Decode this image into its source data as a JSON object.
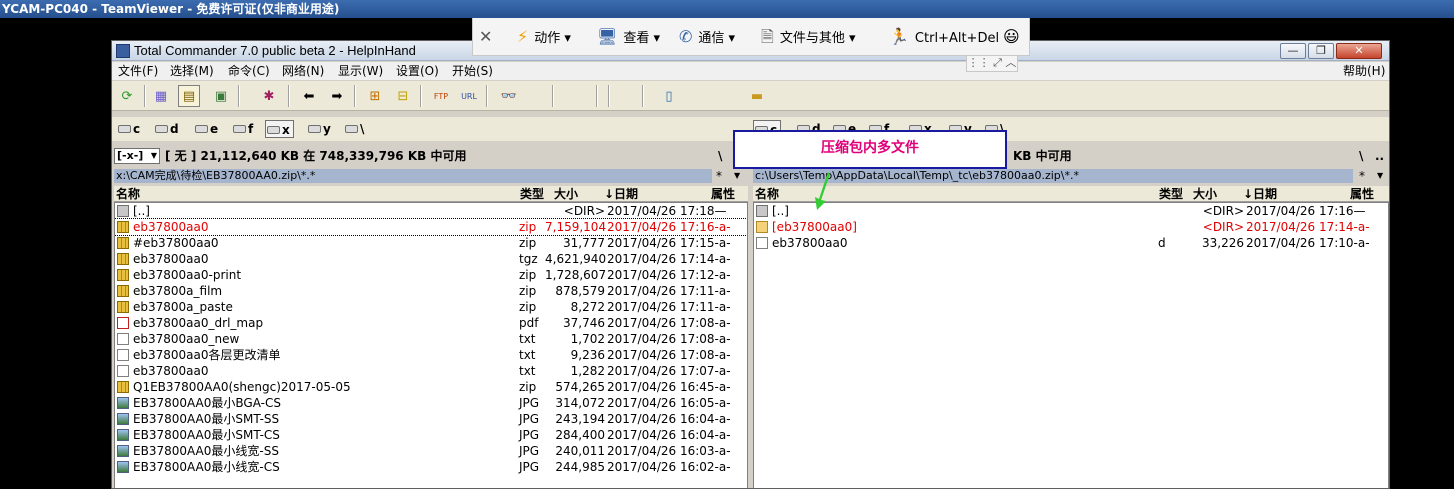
{
  "teamviewer": {
    "title": "YCAM-PC040 - TeamViewer - 免费许可证(仅非商业用途)",
    "toolbar": {
      "close_glyph": "✕",
      "action": "动作",
      "view": "查看",
      "comm": "通信",
      "files": "文件与其他",
      "cad": "Ctrl+Alt+Del",
      "smiley": "😃"
    },
    "sub": "⋮⋮ ⤢ ︿"
  },
  "tc": {
    "title": "Total Commander 7.0 public beta 2 - HelpInHand",
    "winbtn": {
      "min": "—",
      "max": "❐",
      "close": "✕"
    },
    "menu": [
      "文件(F)",
      "选择(M)",
      "命令(C)",
      "网络(N)",
      "显示(W)",
      "设置(O)",
      "开始(S)"
    ],
    "help": "帮助(H)",
    "drives_left": [
      "c",
      "d",
      "e",
      "f",
      "x",
      "y",
      "\\"
    ],
    "drives_right": [
      "c",
      "d",
      "e",
      "f",
      "x",
      "y",
      "\\"
    ],
    "left": {
      "drive_select": "[-x-]",
      "free_info": "[ 无 ]  21,112,640 KB 在 748,339,796 KB 中可用",
      "root_btn": "\\",
      "dots_btn": "..",
      "path": "x:\\CAM完成\\待检\\EB37800AA0.zip\\*.*",
      "star": "*",
      "caret": "▼",
      "columns": {
        "name": "名称",
        "type": "类型",
        "size": "大小",
        "date": "↓日期",
        "attr": "属性"
      },
      "rows": [
        {
          "name": "[..]",
          "type": "",
          "size": "<DIR>",
          "date": "2017/04/26 17:18—",
          "icon": "up",
          "color": "normal"
        },
        {
          "name": "eb37800aa0",
          "type": "zip",
          "size": "7,159,104",
          "date": "2017/04/26 17:16-a-",
          "icon": "zip",
          "color": "red"
        },
        {
          "name": "#eb37800aa0",
          "type": "zip",
          "size": "31,777",
          "date": "2017/04/26 17:15-a-",
          "icon": "zip",
          "color": "normal"
        },
        {
          "name": "eb37800aa0",
          "type": "tgz",
          "size": "4,621,940",
          "date": "2017/04/26 17:14-a-",
          "icon": "zip",
          "color": "normal"
        },
        {
          "name": "eb37800aa0-print",
          "type": "zip",
          "size": "1,728,607",
          "date": "2017/04/26 17:12-a-",
          "icon": "zip",
          "color": "normal"
        },
        {
          "name": "eb37800a_film",
          "type": "zip",
          "size": "878,579",
          "date": "2017/04/26 17:11-a-",
          "icon": "zip",
          "color": "normal"
        },
        {
          "name": "eb37800a_paste",
          "type": "zip",
          "size": "8,272",
          "date": "2017/04/26 17:11-a-",
          "icon": "zip",
          "color": "normal"
        },
        {
          "name": "eb37800aa0_drl_map",
          "type": "pdf",
          "size": "37,746",
          "date": "2017/04/26 17:08-a-",
          "icon": "pdf",
          "color": "normal"
        },
        {
          "name": "eb37800aa0_new",
          "type": "txt",
          "size": "1,702",
          "date": "2017/04/26 17:08-a-",
          "icon": "doc",
          "color": "normal"
        },
        {
          "name": "eb37800aa0各层更改清单",
          "type": "txt",
          "size": "9,236",
          "date": "2017/04/26 17:08-a-",
          "icon": "doc",
          "color": "normal"
        },
        {
          "name": "eb37800aa0",
          "type": "txt",
          "size": "1,282",
          "date": "2017/04/26 17:07-a-",
          "icon": "doc",
          "color": "normal"
        },
        {
          "name": "Q1EB37800AA0(shengc)2017-05-05",
          "type": "zip",
          "size": "574,265",
          "date": "2017/04/26 16:45-a-",
          "icon": "zip",
          "color": "normal"
        },
        {
          "name": "EB37800AA0最小BGA-CS",
          "type": "JPG",
          "size": "314,072",
          "date": "2017/04/26 16:05-a-",
          "icon": "img",
          "color": "normal"
        },
        {
          "name": "EB37800AA0最小SMT-SS",
          "type": "JPG",
          "size": "243,194",
          "date": "2017/04/26 16:04-a-",
          "icon": "img",
          "color": "normal"
        },
        {
          "name": "EB37800AA0最小SMT-CS",
          "type": "JPG",
          "size": "284,400",
          "date": "2017/04/26 16:04-a-",
          "icon": "img",
          "color": "normal"
        },
        {
          "name": "EB37800AA0最小线宽-SS",
          "type": "JPG",
          "size": "240,011",
          "date": "2017/04/26 16:03-a-",
          "icon": "img",
          "color": "normal"
        },
        {
          "name": "EB37800AA0最小线宽-CS",
          "type": "JPG",
          "size": "244,985",
          "date": "2017/04/26 16:02-a-",
          "icon": "img",
          "color": "normal"
        }
      ]
    },
    "right": {
      "free_info": "KB 中可用",
      "root_btn": "\\",
      "dots_btn": "..",
      "path": "c:\\Users\\Temp\\AppData\\Local\\Temp\\_tc\\eb37800aa0.zip\\*.*",
      "star": "*",
      "caret": "▼",
      "columns": {
        "name": "名称",
        "type": "类型",
        "size": "大小",
        "date": "↓日期",
        "attr": "属性"
      },
      "rows": [
        {
          "name": "[..]",
          "type": "",
          "size": "<DIR>",
          "date": "2017/04/26 17:16—",
          "icon": "up",
          "color": "normal"
        },
        {
          "name": "[eb37800aa0]",
          "type": "",
          "size": "<DIR>",
          "date": "2017/04/26 17:14-a-",
          "icon": "folder",
          "color": "red"
        },
        {
          "name": "eb37800aa0",
          "type": "d",
          "size": "33,226",
          "date": "2017/04/26 17:10-a-",
          "icon": "doc",
          "color": "normal"
        }
      ]
    }
  },
  "annotation": {
    "text": "压缩包内多文件",
    "color": "#e0007a"
  }
}
